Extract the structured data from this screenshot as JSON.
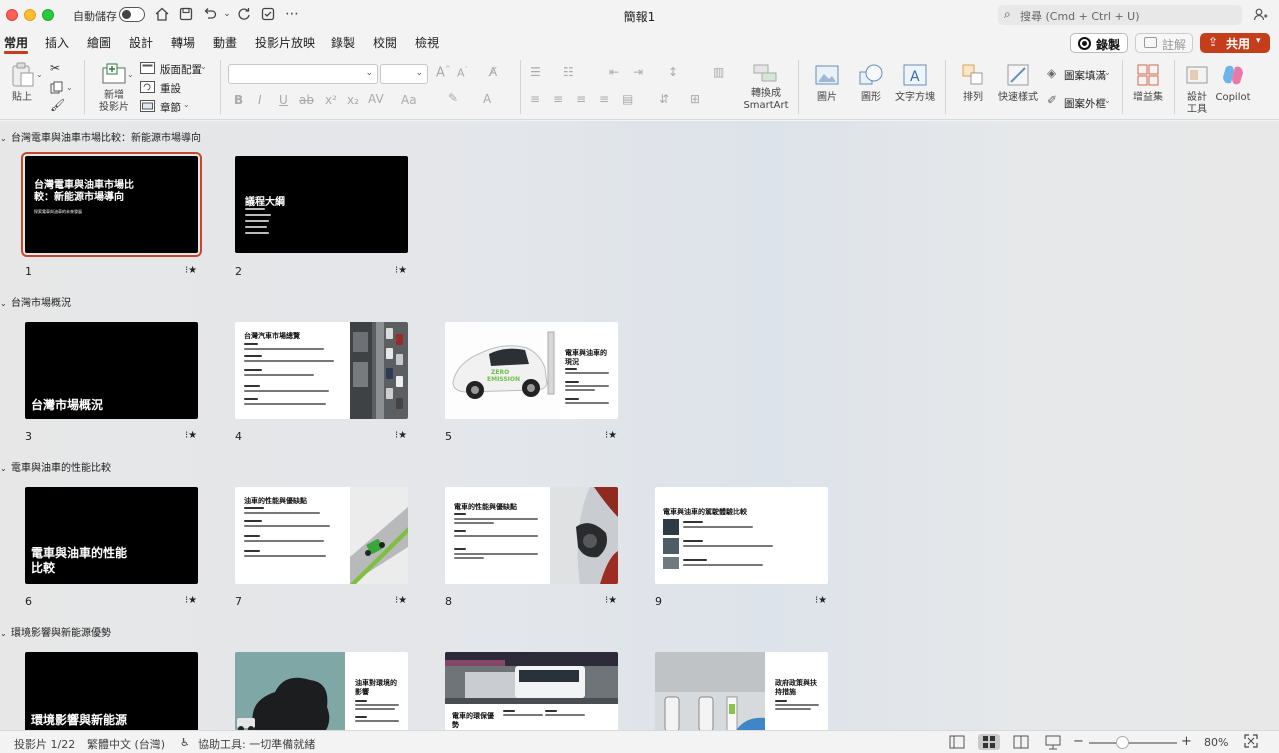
{
  "window": {
    "title": "簡報1",
    "autosave_label": "自動儲存",
    "search_placeholder": "搜尋 (Cmd + Ctrl + U)"
  },
  "tabs": [
    "常用",
    "插入",
    "繪圖",
    "設計",
    "轉場",
    "動畫",
    "投影片放映",
    "錄製",
    "校閱",
    "檢視"
  ],
  "actions": {
    "record": "錄製",
    "comments": "註解",
    "share": "共用"
  },
  "ribbon": {
    "paste": "貼上",
    "new_slide_1": "新增",
    "new_slide_2": "投影片",
    "layout": "版面配置",
    "reset": "重設",
    "section": "章節",
    "convert_1": "轉換成",
    "convert_2": "SmartArt",
    "picture": "圖片",
    "shapes": "圖形",
    "textbox": "文字方塊",
    "arrange": "排列",
    "quick_styles": "快速樣式",
    "shape_fill": "圖案填滿",
    "shape_outline": "圖案外框",
    "addins": "增益集",
    "designer_1": "設計",
    "designer_2": "工具",
    "copilot": "Copilot"
  },
  "sections": [
    {
      "name": "台灣電車與油車市場比較：新能源市場導向",
      "slides": [
        {
          "num": "1",
          "kind": "title",
          "title_lines": [
            "台灣電車與油車市場比",
            "較：新能源市場導向"
          ],
          "subtitle": "探索電車與油車的未來發展",
          "selected": true
        },
        {
          "num": "2",
          "kind": "agenda",
          "title_lines": [
            "議程大綱"
          ]
        }
      ]
    },
    {
      "name": "台灣市場概況",
      "slides": [
        {
          "num": "3",
          "kind": "section",
          "title_lines": [
            "台灣市場概況"
          ]
        },
        {
          "num": "4",
          "kind": "content-right-photo",
          "title_lines": [
            "台灣汽車市場總覽"
          ],
          "photo": "traffic"
        },
        {
          "num": "5",
          "kind": "photo-left",
          "title_lines": [
            "電車與油車的",
            "現況"
          ],
          "photo": "ev"
        }
      ]
    },
    {
      "name": "電車與油車的性能比較",
      "slides": [
        {
          "num": "6",
          "kind": "section",
          "title_lines": [
            "電車與油車的性能",
            "比較"
          ]
        },
        {
          "num": "7",
          "kind": "content-right-photo",
          "title_lines": [
            "油車的性能與優缺點"
          ],
          "photo": "road"
        },
        {
          "num": "8",
          "kind": "content-right-photo",
          "title_lines": [
            "電車的性能與優缺點"
          ],
          "photo": "charger"
        },
        {
          "num": "9",
          "kind": "list",
          "title_lines": [
            "電車與油車的駕駛體驗比較"
          ]
        }
      ]
    },
    {
      "name": "環境影響與新能源優勢",
      "slides": [
        {
          "num": "",
          "kind": "section",
          "title_lines": [
            "環境影響與新能源"
          ]
        },
        {
          "num": "",
          "kind": "photo-left",
          "title_lines": [
            "油車對環境的",
            "影響"
          ],
          "photo": "smoke"
        },
        {
          "num": "",
          "kind": "photo-top",
          "title_lines": [
            "電車的環保優",
            "勢"
          ],
          "photo": "bus"
        },
        {
          "num": "",
          "kind": "photo-left",
          "title_lines": [
            "政府政策與扶",
            "持措施"
          ],
          "photo": "station"
        }
      ]
    }
  ],
  "status": {
    "slide_count": "投影片 1/22",
    "language": "繁體中文 (台灣)",
    "accessibility": "協助工具: 一切準備就緒",
    "zoom": "80%"
  }
}
